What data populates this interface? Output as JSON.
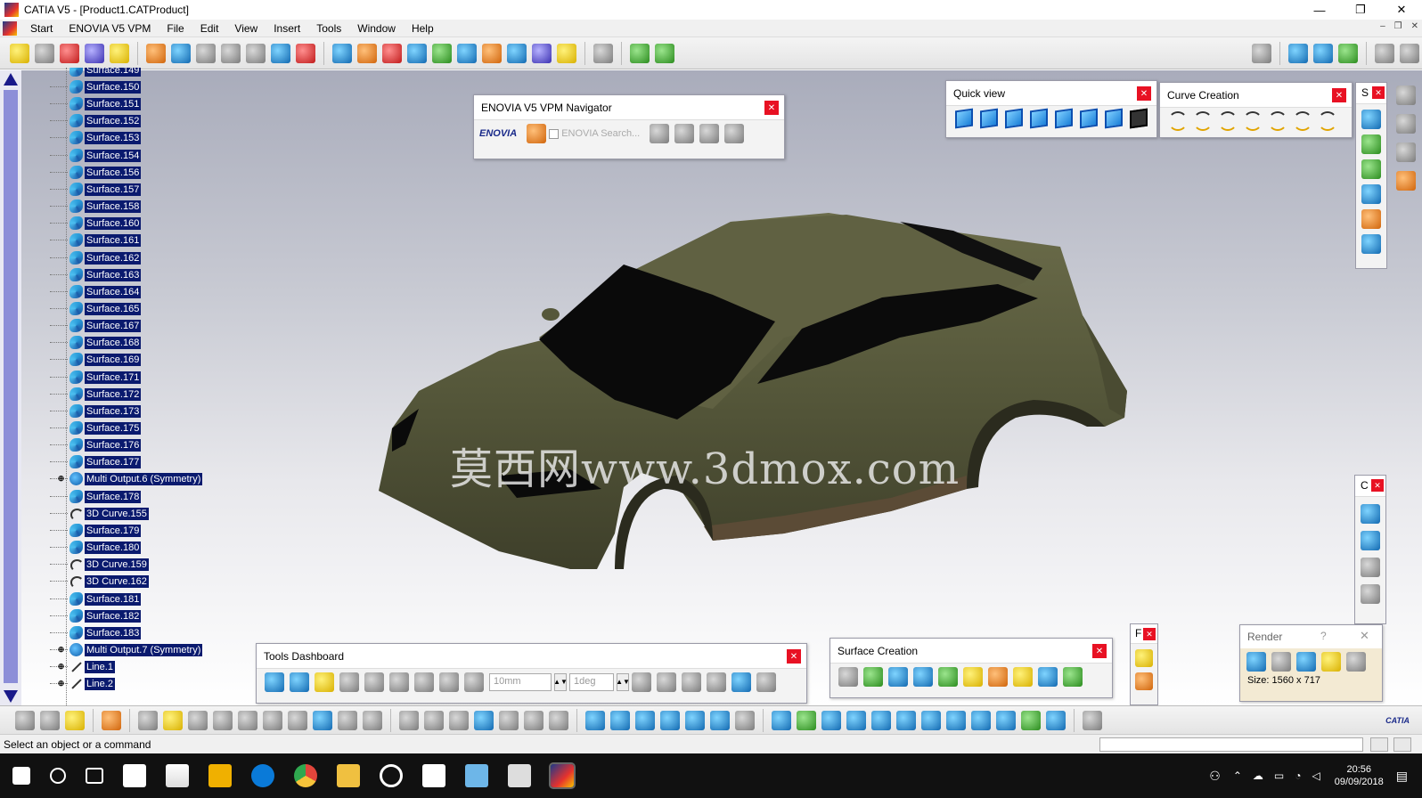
{
  "window": {
    "title": "CATIA V5 - [Product1.CATProduct]",
    "controls": [
      "—",
      "❐",
      "✕"
    ],
    "mdi_controls": [
      "–",
      "❐",
      "✕"
    ]
  },
  "menu": {
    "items": [
      "Start",
      "ENOVIA V5 VPM",
      "File",
      "Edit",
      "View",
      "Insert",
      "Tools",
      "Window",
      "Help"
    ]
  },
  "tree": {
    "partial_top": "Surface.149",
    "nodes": [
      {
        "label": "Surface.150",
        "type": "surface"
      },
      {
        "label": "Surface.151",
        "type": "surface"
      },
      {
        "label": "Surface.152",
        "type": "surface"
      },
      {
        "label": "Surface.153",
        "type": "surface"
      },
      {
        "label": "Surface.154",
        "type": "surface"
      },
      {
        "label": "Surface.156",
        "type": "surface"
      },
      {
        "label": "Surface.157",
        "type": "surface"
      },
      {
        "label": "Surface.158",
        "type": "surface"
      },
      {
        "label": "Surface.160",
        "type": "surface"
      },
      {
        "label": "Surface.161",
        "type": "surface"
      },
      {
        "label": "Surface.162",
        "type": "surface"
      },
      {
        "label": "Surface.163",
        "type": "surface"
      },
      {
        "label": "Surface.164",
        "type": "surface"
      },
      {
        "label": "Surface.165",
        "type": "surface"
      },
      {
        "label": "Surface.167",
        "type": "surface"
      },
      {
        "label": "Surface.168",
        "type": "surface"
      },
      {
        "label": "Surface.169",
        "type": "surface"
      },
      {
        "label": "Surface.171",
        "type": "surface"
      },
      {
        "label": "Surface.172",
        "type": "surface"
      },
      {
        "label": "Surface.173",
        "type": "surface"
      },
      {
        "label": "Surface.175",
        "type": "surface"
      },
      {
        "label": "Surface.176",
        "type": "surface"
      },
      {
        "label": "Surface.177",
        "type": "surface"
      },
      {
        "label": "Multi Output.6 (Symmetry)",
        "type": "multi"
      },
      {
        "label": "Surface.178",
        "type": "surface"
      },
      {
        "label": "3D Curve.155",
        "type": "curve"
      },
      {
        "label": "Surface.179",
        "type": "surface"
      },
      {
        "label": "Surface.180",
        "type": "surface"
      },
      {
        "label": "3D Curve.159",
        "type": "curve"
      },
      {
        "label": "3D Curve.162",
        "type": "curve"
      },
      {
        "label": "Surface.181",
        "type": "surface"
      },
      {
        "label": "Surface.182",
        "type": "surface"
      },
      {
        "label": "Surface.183",
        "type": "surface"
      },
      {
        "label": "Multi Output.7 (Symmetry)",
        "type": "multi"
      },
      {
        "label": "Line.1",
        "type": "line"
      },
      {
        "label": "Line.2",
        "type": "line"
      }
    ]
  },
  "panels": {
    "enovia": {
      "title": "ENOVIA V5 VPM Navigator",
      "search_placeholder": "ENOVIA Search...",
      "logo": "ENOVIA"
    },
    "quick_view": {
      "title": "Quick view"
    },
    "curve_creation": {
      "title": "Curve Creation"
    },
    "side_s": {
      "title": "S"
    },
    "side_c": {
      "title": "C"
    },
    "side_f": {
      "title": "F"
    },
    "tools_dashboard": {
      "title": "Tools Dashboard",
      "distance_value": "10mm",
      "angle_value": "1deg"
    },
    "surface_creation": {
      "title": "Surface Creation"
    },
    "render": {
      "title": "Render",
      "help": "?",
      "size_label": "Size: 1560 x 717"
    }
  },
  "viewport": {
    "watermark": "莫西网www.3dmox.com",
    "model_color": "#5a5a3e"
  },
  "status": {
    "message": "Select an object or a command"
  },
  "taskbar": {
    "time": "20:56",
    "date": "09/09/2018"
  },
  "colors": {
    "tree_highlight": "#0a1a6e",
    "close_red": "#e81123"
  }
}
